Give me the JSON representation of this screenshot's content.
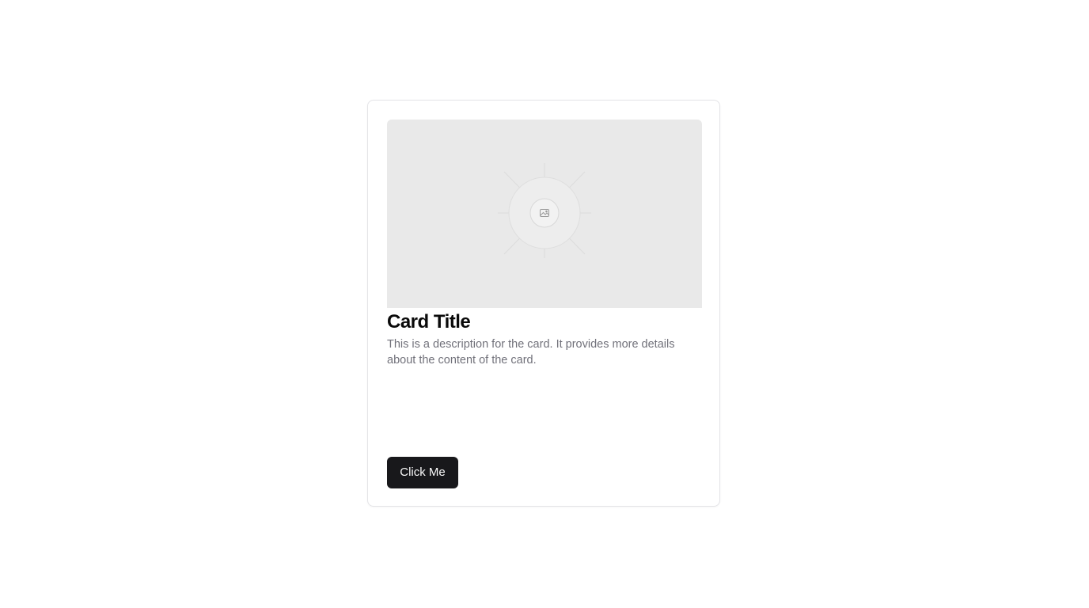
{
  "card": {
    "image_icon": "image-placeholder-icon",
    "title": "Card Title",
    "description": "This is a description for the card. It provides more details about the content of the card.",
    "button_label": "Click Me"
  },
  "colors": {
    "button_bg": "#18181b",
    "button_text": "#fafafa",
    "title": "#0a0a0a",
    "description": "#71717a",
    "image_bg": "#e9e9e9",
    "border": "#e4e4e7"
  }
}
